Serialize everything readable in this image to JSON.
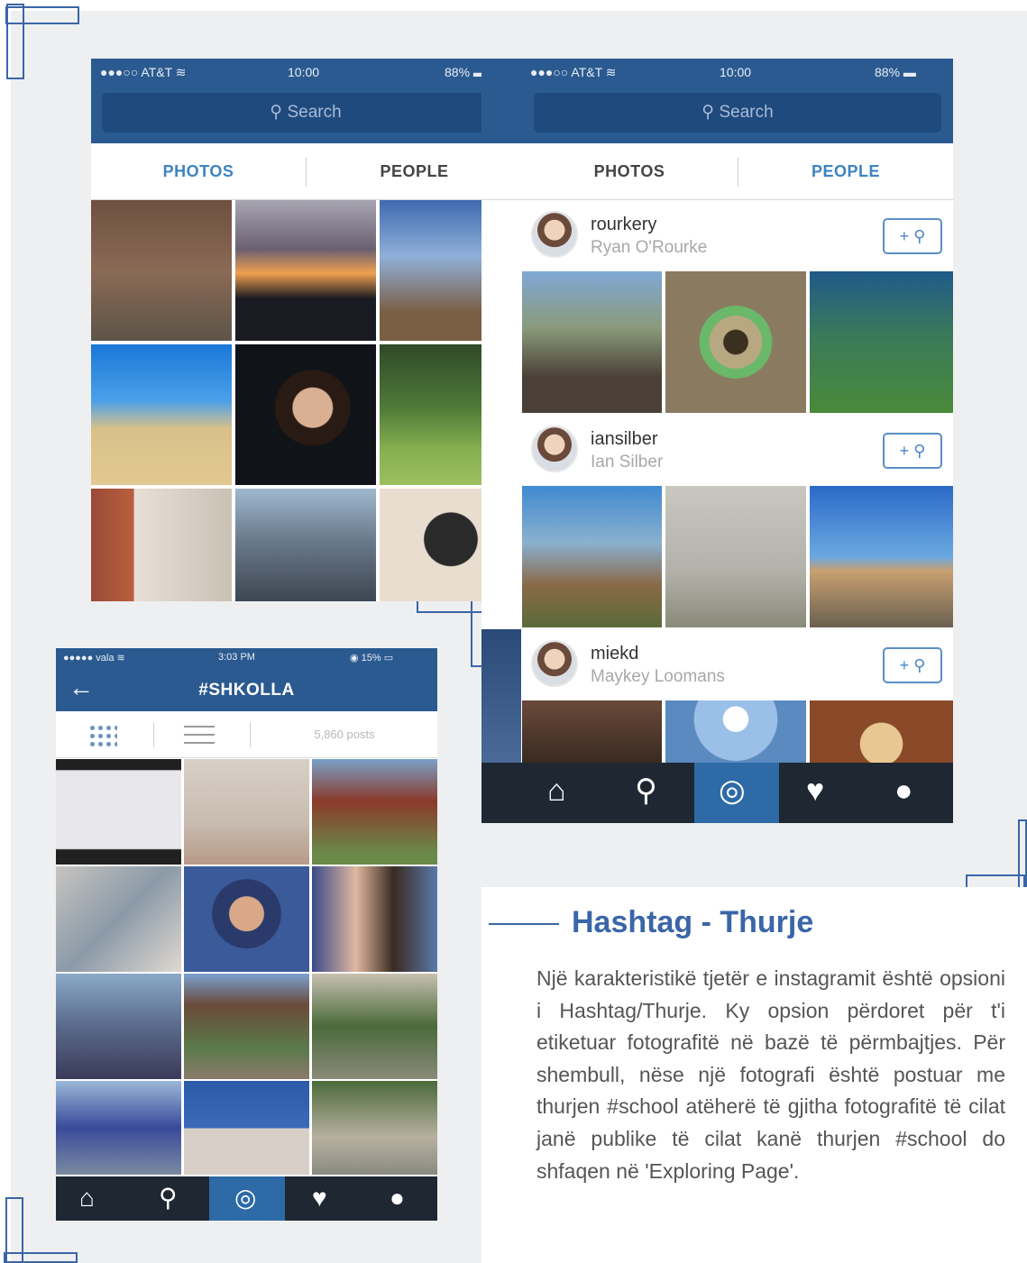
{
  "colors": {
    "accent": "#3a66a8",
    "nav_blue": "#2b5a90",
    "tab_active": "#3d84c1",
    "tabbar": "#1e2732"
  },
  "explore_photos": {
    "status": {
      "carrier": "●●●○○ AT&T ≋",
      "time": "10:00",
      "battery": "88% ▬"
    },
    "search_placeholder": "Search",
    "tabs": [
      "PHOTOS",
      "PEOPLE"
    ]
  },
  "explore_people": {
    "status": {
      "carrier": "●●●○○ AT&T ≋",
      "time": "10:00",
      "battery": "88% ▬"
    },
    "search_placeholder": "Search",
    "tabs": [
      "PHOTOS",
      "PEOPLE"
    ],
    "users": [
      {
        "username": "rourkery",
        "full_name": "Ryan O'Rourke",
        "follow": "+ ⚲"
      },
      {
        "username": "iansilber",
        "full_name": "Ian Silber",
        "follow": "+ ⚲"
      },
      {
        "username": "miekd",
        "full_name": "Maykey Loomans",
        "follow": "+ ⚲"
      }
    ],
    "tabbar_icons": [
      "home-icon",
      "search-icon",
      "camera-icon",
      "activity-icon",
      "profile-icon"
    ]
  },
  "hashtag_phone": {
    "status": {
      "carrier": "●●●●● vala ≋",
      "time": "3:03 PM",
      "battery": "◉ 15% ▭"
    },
    "back_icon": "←",
    "title": "#SHKOLLA",
    "post_count": "5,860 posts",
    "view_icons": [
      "grid-view-icon",
      "list-view-icon"
    ],
    "tabbar_icons": [
      "home-icon",
      "search-icon",
      "camera-icon",
      "activity-icon",
      "profile-icon"
    ]
  },
  "article": {
    "title": "Hashtag - Thurje",
    "body": "Një karakteristikë tjetër e instagramit është opsioni i Hashtag/Thurje. Ky opsion përdoret për t'i etiketuar fotografitë në bazë të përmbajtjes. Për shembull, nëse një fotografi është postuar me thurjen #school atëherë të gjitha fotografitë të cilat janë publike të cilat kanë thurjen #school do shfaqen në 'Exploring Page'."
  }
}
